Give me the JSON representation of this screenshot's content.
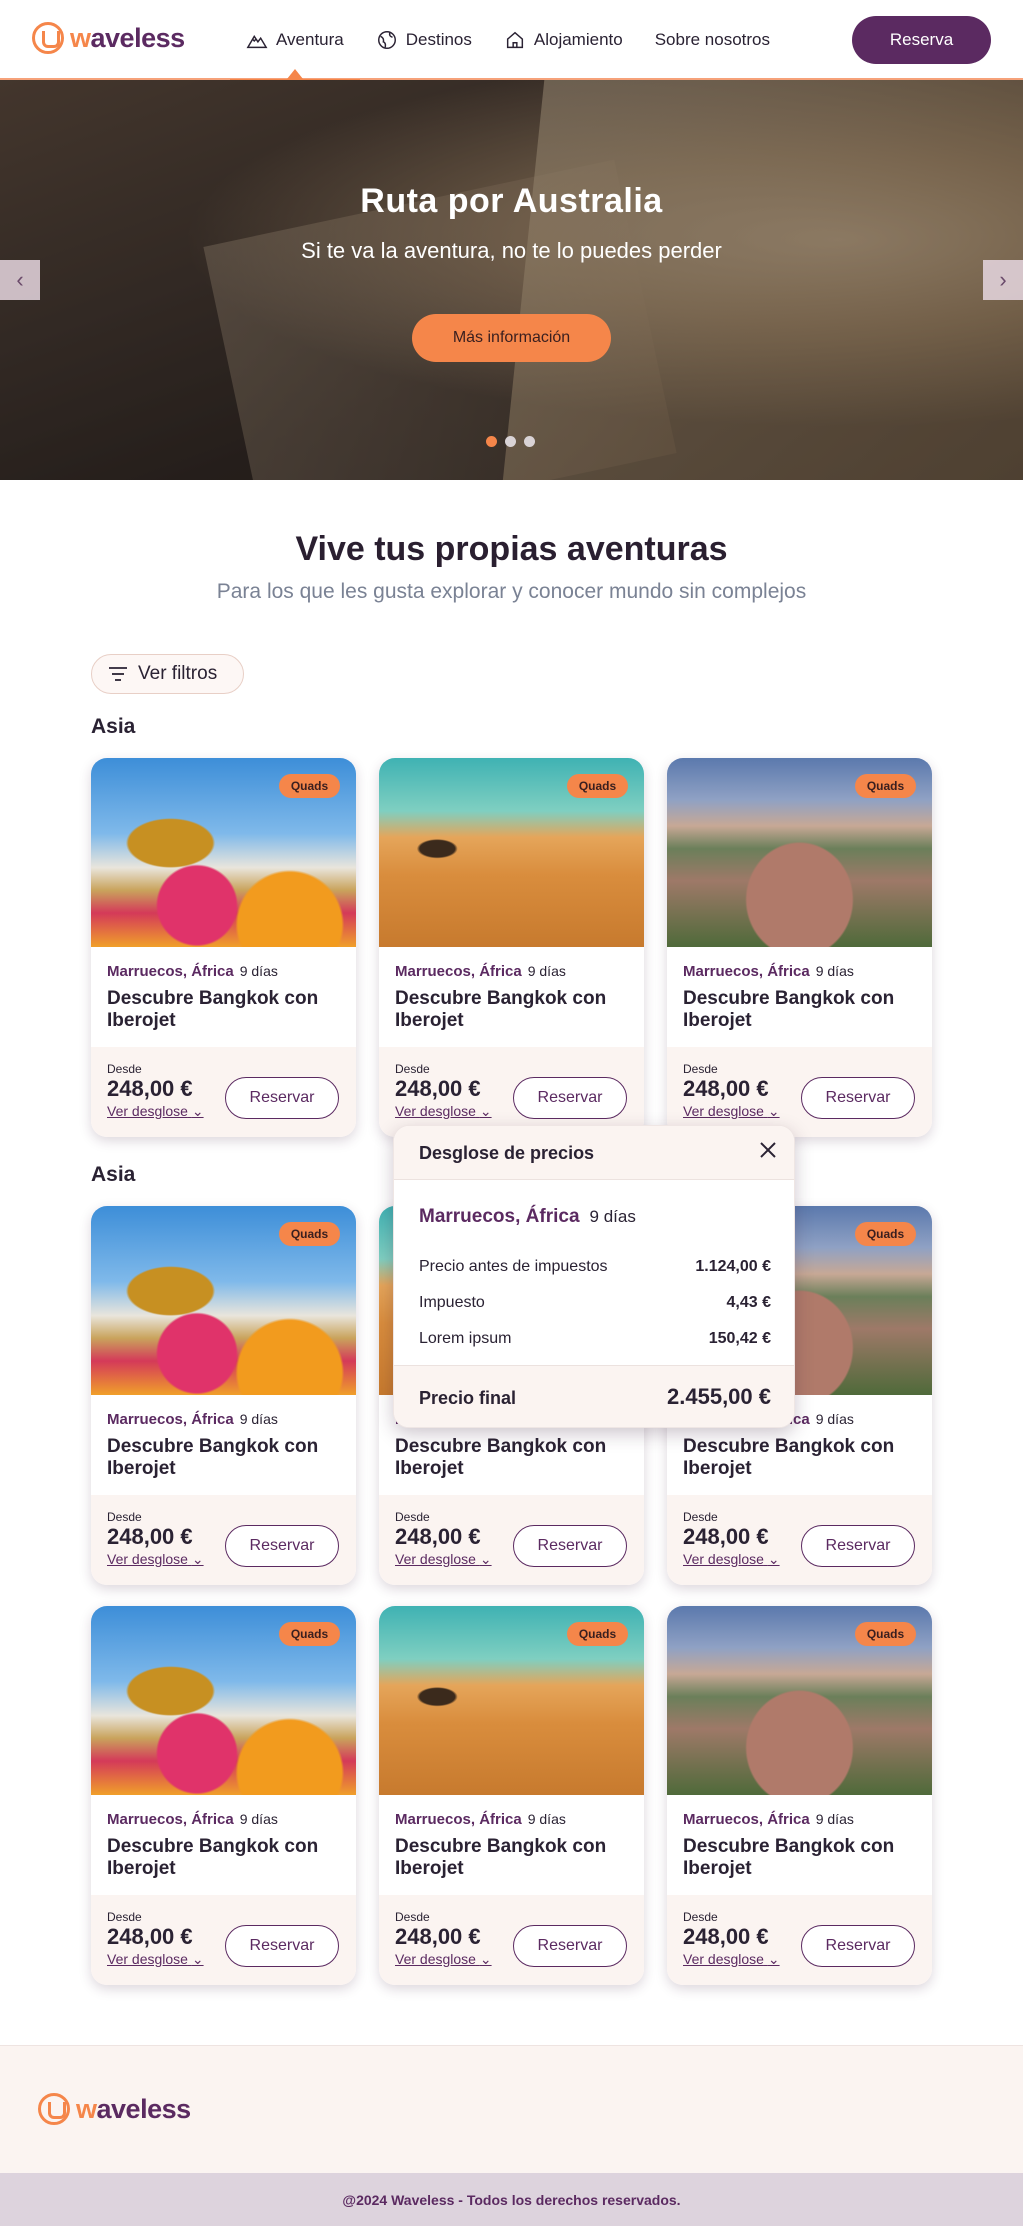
{
  "brand": {
    "name": "waveless"
  },
  "nav": {
    "items": [
      {
        "label": "Aventura",
        "icon": "mountain-icon"
      },
      {
        "label": "Destinos",
        "icon": "globe-icon"
      },
      {
        "label": "Alojamiento",
        "icon": "house-icon"
      },
      {
        "label": "Sobre nosotros"
      }
    ],
    "cta": "Reserva"
  },
  "hero": {
    "title": "Ruta por Australia",
    "subtitle": "Si te va la aventura, no te lo puedes perder",
    "button": "Más información",
    "prev": "‹",
    "next": "›"
  },
  "section": {
    "title": "Vive tus propias aventuras",
    "subtitle": "Para los que les gusta explorar y conocer mundo sin complejos",
    "filters": "Ver filtros"
  },
  "groups": [
    {
      "title": "Asia"
    },
    {
      "title": "Asia"
    }
  ],
  "card": {
    "badge": "Quads",
    "location": "Marruecos, África",
    "days": "9 días",
    "title": "Descubre Bangkok con Iberojet",
    "from": "Desde",
    "price": "248,00 €",
    "breakdown": "Ver desglose",
    "reserve": "Reservar"
  },
  "popup": {
    "title": "Desglose de precios",
    "location": "Marruecos, África",
    "days": "9 días",
    "rows": [
      {
        "label": "Precio antes de impuestos",
        "value": "1.124,00 €"
      },
      {
        "label": "Impuesto",
        "value": "4,43 €"
      },
      {
        "label": "Lorem ipsum",
        "value": "150,42 €"
      }
    ],
    "final_label": "Precio final",
    "final_value": "2.455,00 €"
  },
  "footer": {
    "copyright": "@2024 Waveless - Todos los derechos reservados."
  },
  "colors": {
    "primary": "#5b2a61",
    "accent": "#f5864a",
    "muted": "#7a8294"
  }
}
